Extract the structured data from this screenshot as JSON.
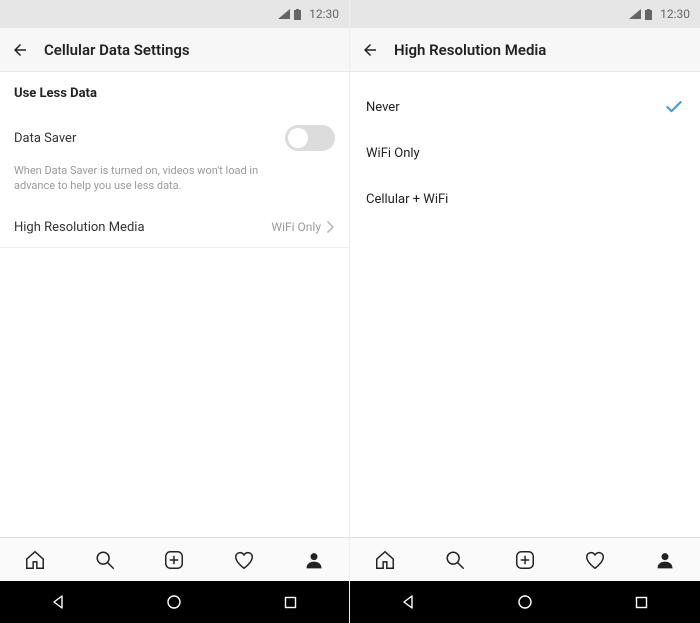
{
  "statusbar": {
    "time": "12:30"
  },
  "left": {
    "header": {
      "title": "Cellular Data Settings"
    },
    "section_title": "Use Less Data",
    "data_saver_label": "Data Saver",
    "data_saver_on": false,
    "data_saver_desc": "When Data Saver is turned on, videos won't load in advance to help you use less data.",
    "hires_label": "High Resolution Media",
    "hires_value": "WiFi Only"
  },
  "right": {
    "header": {
      "title": "High Resolution Media"
    },
    "options": {
      "0": "Never",
      "1": "WiFi Only",
      "2": "Cellular + WiFi"
    },
    "selected_index": 0
  },
  "colors": {
    "accent": "#3897f0"
  }
}
